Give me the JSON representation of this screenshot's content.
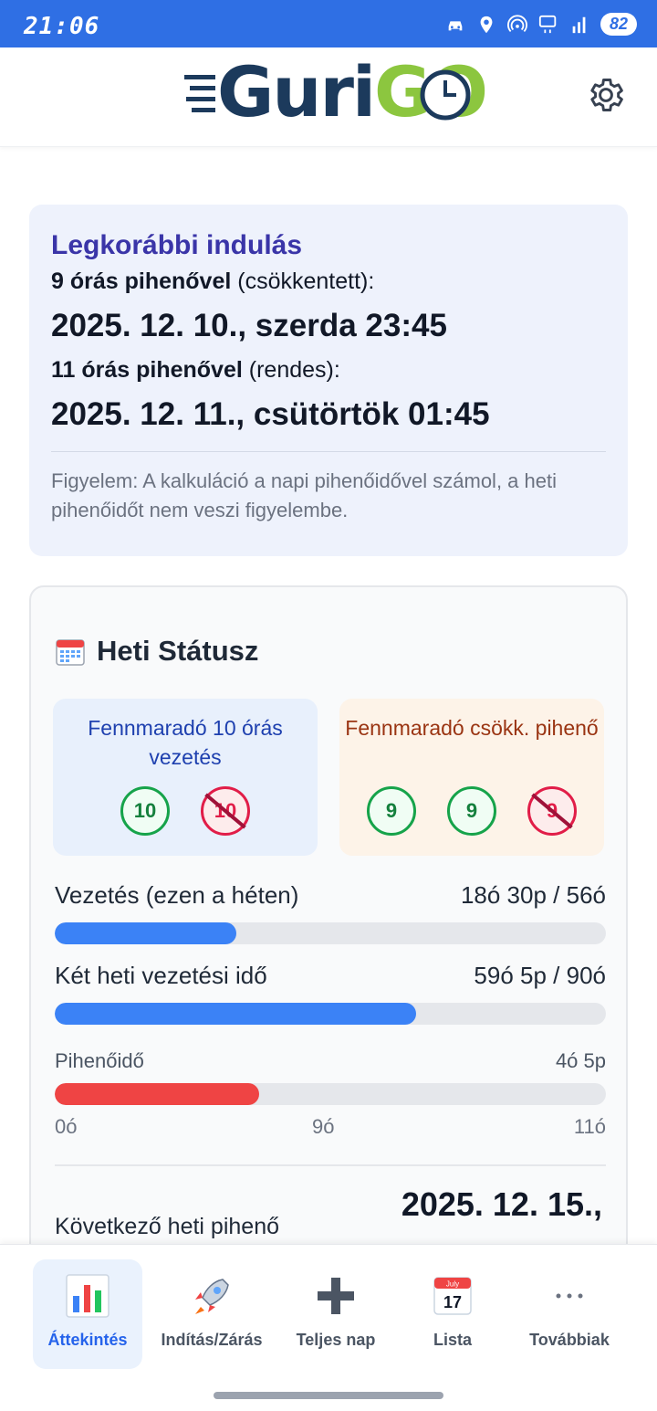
{
  "statusbar": {
    "time": "21:06",
    "battery": "82"
  },
  "header": {
    "logo_part1": "Guri",
    "logo_part2": "GO"
  },
  "earliest": {
    "title": "Legkorábbi indulás",
    "reduced_bold": "9 órás pihenővel",
    "reduced_rest": " (csökkentett):",
    "reduced_date": "2025. 12. 10., szerda 23:45",
    "normal_bold": "11 órás pihenővel",
    "normal_rest": " (rendes):",
    "normal_date": "2025. 12. 11., csütörtök 01:45",
    "note": "Figyelem: A kalkuláció a napi pihenőidővel számol, a heti pihenőidőt nem veszi figyelembe."
  },
  "weekly": {
    "title": "Heti Státusz",
    "box_drive": {
      "label": "Fennmaradó 10 órás vezetés",
      "circles": [
        {
          "value": "10",
          "used": false
        },
        {
          "value": "10",
          "used": true
        }
      ]
    },
    "box_rest": {
      "label": "Fennmaradó csökk. pihenő",
      "circles": [
        {
          "value": "9",
          "used": false
        },
        {
          "value": "9",
          "used": false
        },
        {
          "value": "9",
          "used": true
        }
      ]
    },
    "driving_week": {
      "label": "Vezetés (ezen a héten)",
      "value": "18ó 30p / 56ó",
      "progress": 0.33,
      "color": "#3b82f6"
    },
    "driving_twoweek": {
      "label": "Két heti vezetési idő",
      "value": "59ó 5p / 90ó",
      "progress": 0.656,
      "color": "#3b82f6"
    },
    "rest": {
      "label": "Pihenőidő",
      "value": "4ó 5p",
      "progress": 0.371,
      "color": "#ef4444"
    },
    "ticks": [
      "0ó",
      "9ó",
      "11ó"
    ],
    "next_rest_label": "Következő heti pihenő",
    "next_rest_date": "2025. 12. 15.,"
  },
  "nav": [
    {
      "label": "Áttekintés",
      "icon": "bar-chart-icon",
      "active": true
    },
    {
      "label": "Indítás/Zárás",
      "icon": "rocket-icon",
      "active": false
    },
    {
      "label": "Teljes nap",
      "icon": "plus-icon",
      "active": false
    },
    {
      "label": "Lista",
      "icon": "calendar-icon",
      "active": false
    },
    {
      "label": "Továbbiak",
      "icon": "more-icon",
      "active": false
    }
  ],
  "calendar_icon_text": {
    "month": "July",
    "day": "17"
  }
}
